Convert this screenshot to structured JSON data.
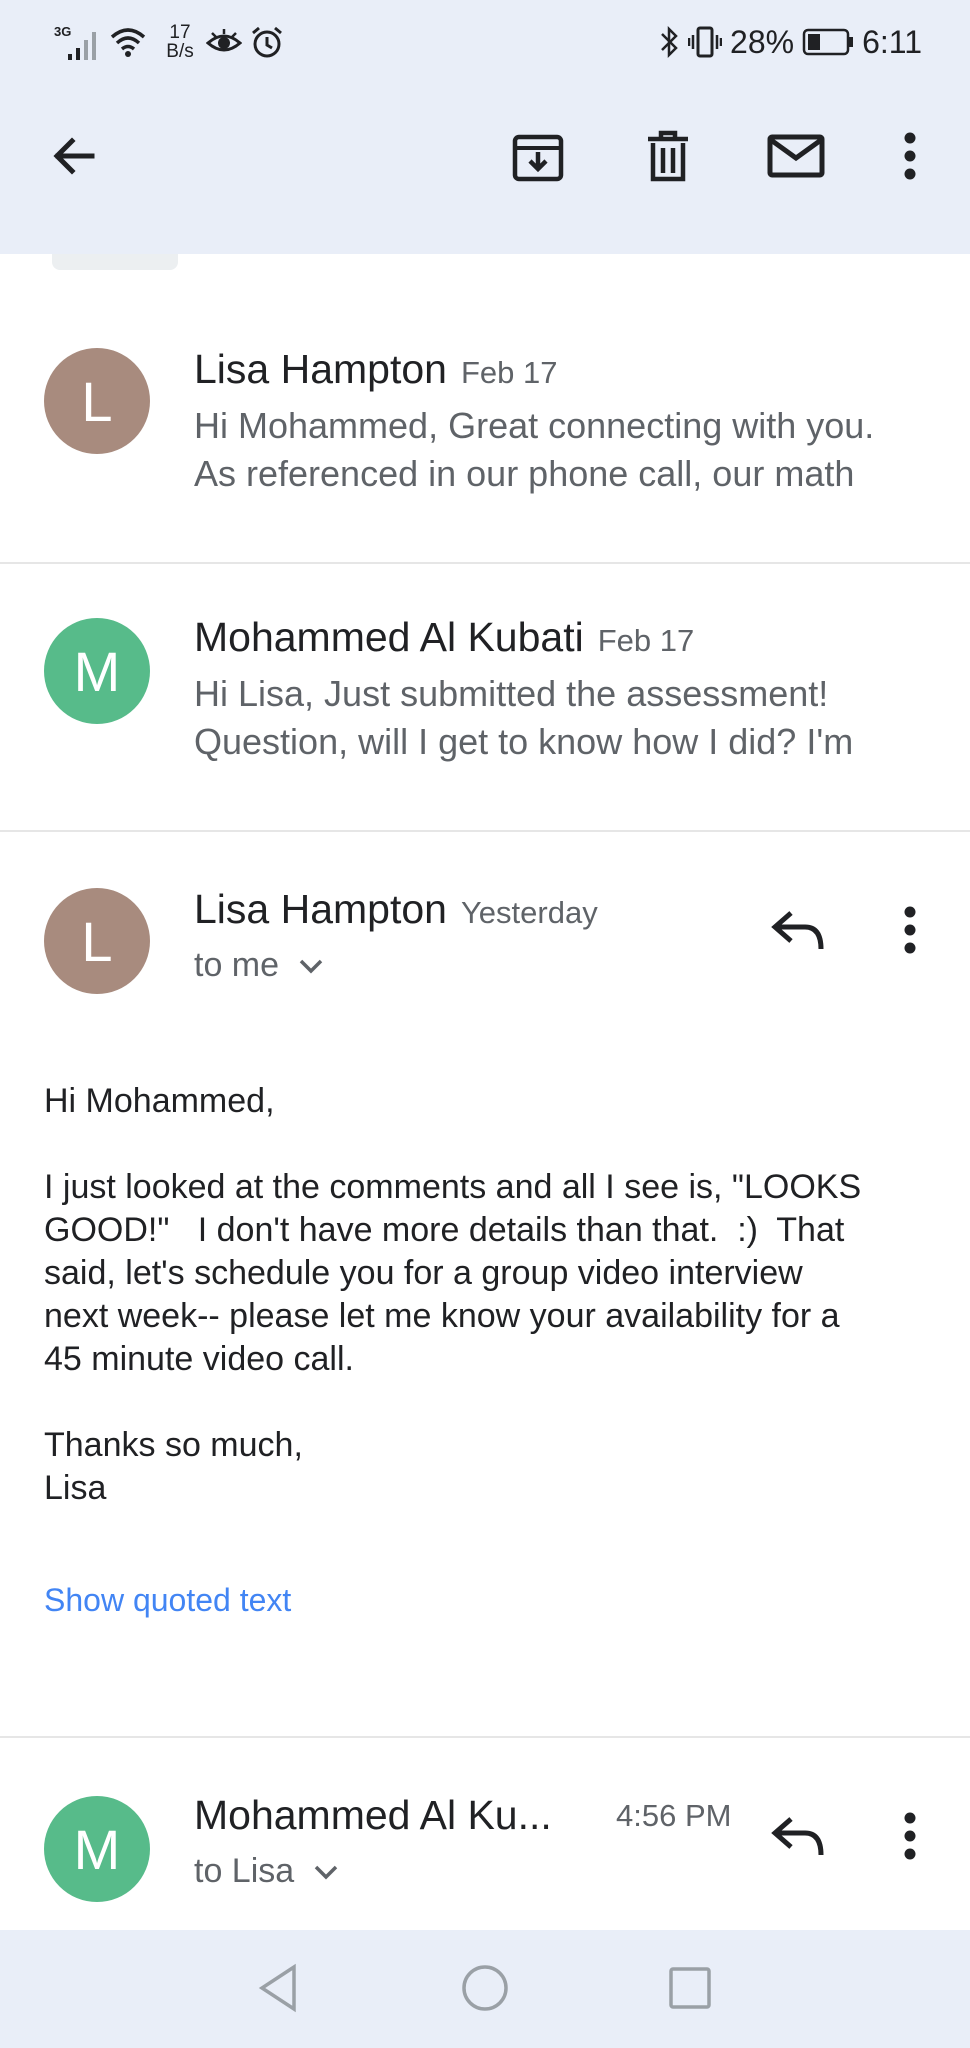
{
  "status_bar": {
    "network": "3G",
    "speed_value": "17",
    "speed_unit": "B/s",
    "battery_percent": "28%",
    "time": "6:11"
  },
  "app_bar": {
    "icons": [
      "back-arrow-icon",
      "archive-icon",
      "delete-icon",
      "mark-unread-icon",
      "more-vert-icon"
    ]
  },
  "thread": {
    "collapsed": [
      {
        "avatar_letter": "L",
        "sender": "Lisa Hampton",
        "date": "Feb 17",
        "snippet_line1": "Hi Mohammed, Great connecting with you.",
        "snippet_line2": "As referenced in our phone call, our math"
      },
      {
        "avatar_letter": "M",
        "sender": "Mohammed Al Kubati",
        "date": "Feb 17",
        "snippet_line1": "Hi Lisa, Just submitted the assessment!",
        "snippet_line2": "Question, will I get to know how I did? I'm"
      }
    ],
    "expanded": {
      "avatar_letter": "L",
      "sender": "Lisa Hampton",
      "date": "Yesterday",
      "recipient": "to me",
      "body_greeting": "Hi Mohammed,",
      "body_l1": "I just looked at the comments and all I see is, \"LOOKS",
      "body_l2": "GOOD!\"   I don't have more details than that.  :)  That",
      "body_l3": "said, let's schedule you for a group video interview",
      "body_l4": "next week-- please let me know your availability for a",
      "body_l5": "45 minute video call.",
      "body_signoff": "Thanks so much,",
      "body_name": "Lisa",
      "show_quoted": "Show quoted text"
    },
    "last": {
      "avatar_letter": "M",
      "sender": "Mohammed Al Ku...",
      "time": "4:56 PM",
      "recipient": "to Lisa"
    }
  },
  "nav_bar": {
    "icons": [
      "nav-back-icon",
      "nav-home-icon",
      "nav-recents-icon"
    ]
  }
}
